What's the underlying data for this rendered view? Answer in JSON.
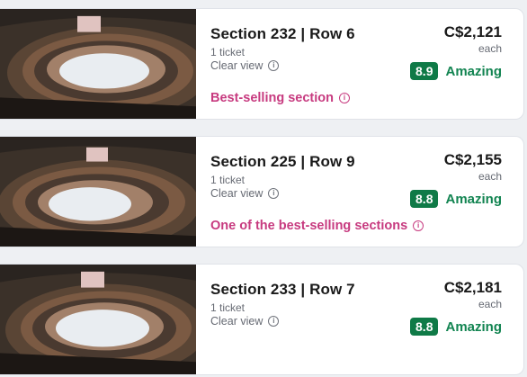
{
  "listings": [
    {
      "section": "Section 232 | Row 6",
      "quantity": "1 ticket",
      "view": "Clear view",
      "price": "C$2,121",
      "price_unit": "each",
      "score": "8.9",
      "rating_label": "Amazing",
      "badge": "Best-selling section"
    },
    {
      "section": "Section 225 | Row 9",
      "quantity": "1 ticket",
      "view": "Clear view",
      "price": "C$2,155",
      "price_unit": "each",
      "score": "8.8",
      "rating_label": "Amazing",
      "badge": "One of the best-selling sections"
    },
    {
      "section": "Section 233 | Row 7",
      "quantity": "1 ticket",
      "view": "Clear view",
      "price": "C$2,181",
      "price_unit": "each",
      "score": "8.8",
      "rating_label": "Amazing"
    }
  ],
  "colors": {
    "score_bg": "#0f7a47",
    "rating_text": "#128451",
    "badge_text": "#c73a7f"
  },
  "icons": {
    "info": "info-icon",
    "arena_view": "arena-view-image"
  }
}
